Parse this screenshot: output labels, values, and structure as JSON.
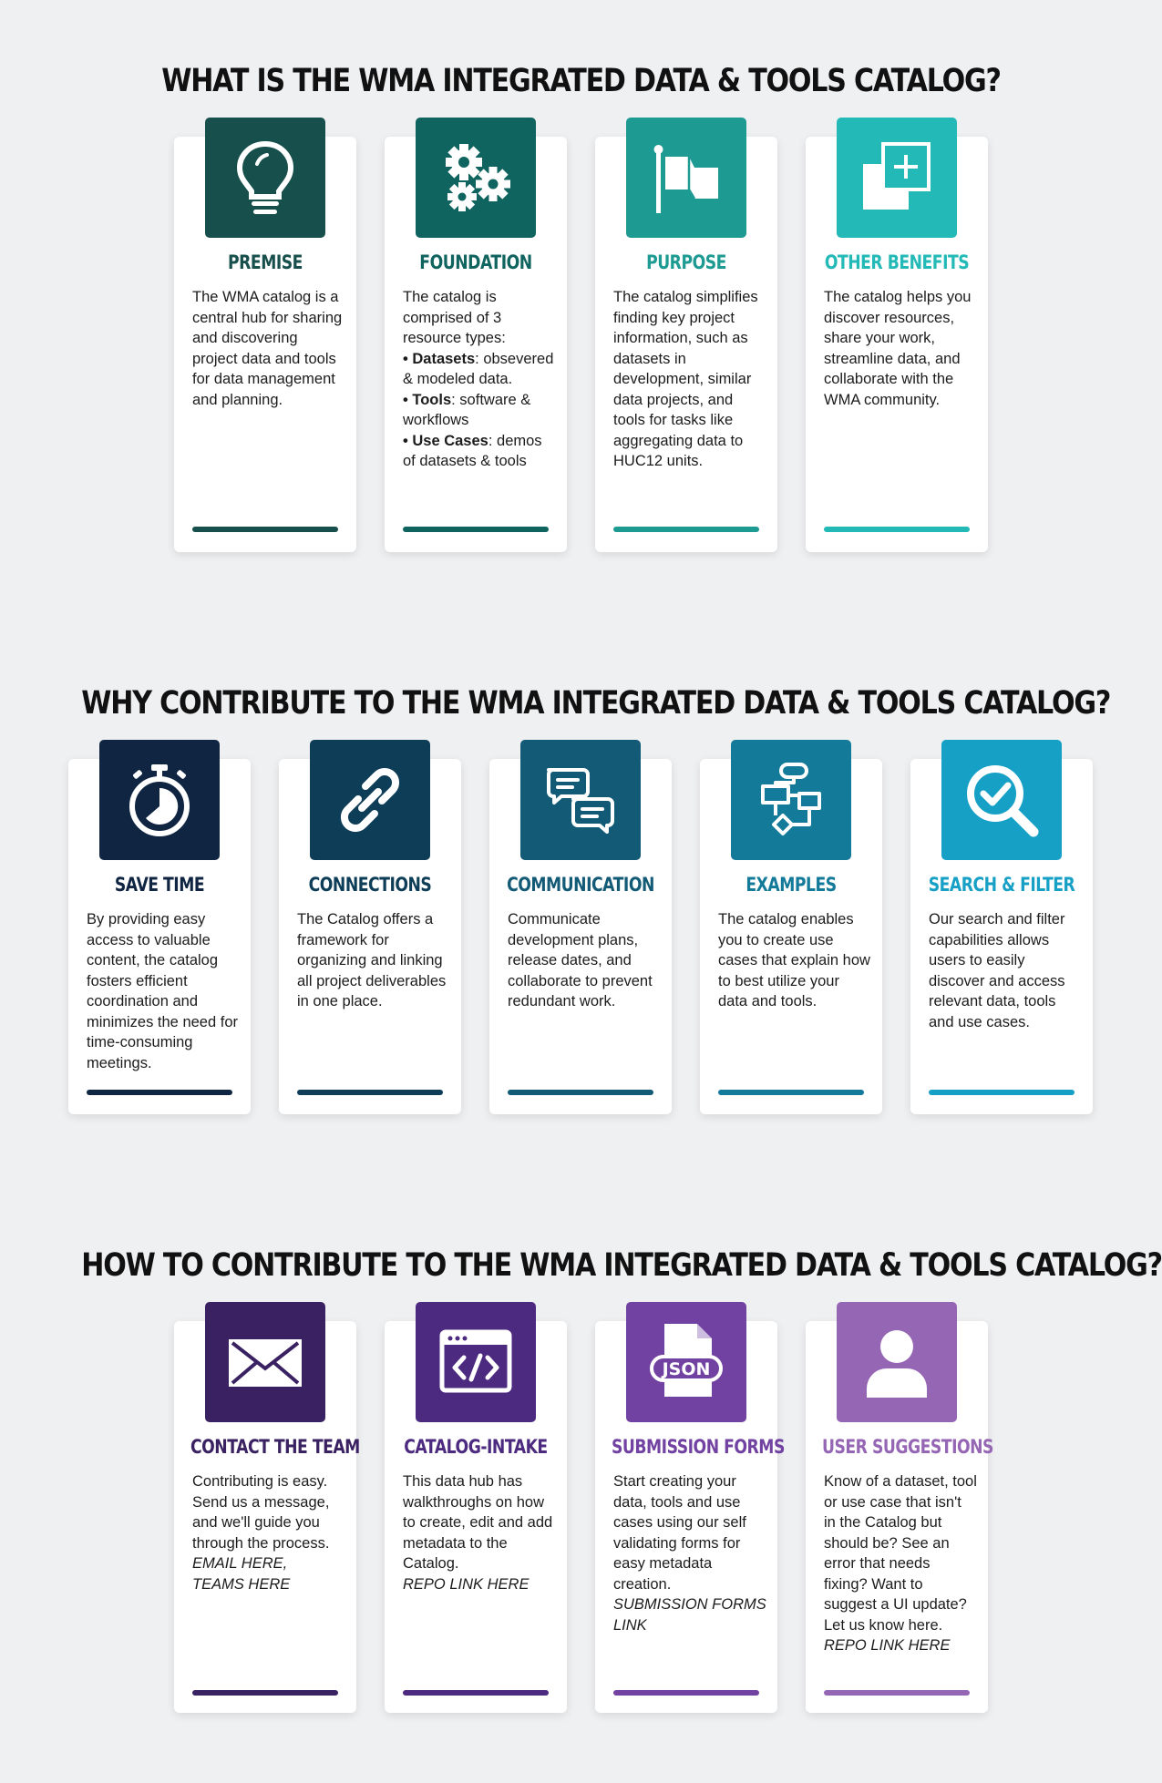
{
  "colors": {
    "background": "#eff0f2",
    "premise": "#174f4c",
    "foundation": "#10645f",
    "purpose": "#1d9a92",
    "other_benefits": "#23b9b6",
    "save_time": "#102542",
    "connections": "#0e3d57",
    "communication": "#125a75",
    "examples": "#137a99",
    "search_filter": "#17a0c6",
    "contact_team": "#3a2262",
    "catalog_intake": "#4c2a80",
    "submission_forms": "#7142a1",
    "user_suggestions": "#9566b4"
  },
  "section_what": {
    "heading": "WHAT IS THE WMA INTEGRATED DATA & TOOLS CATALOG?",
    "cards": [
      {
        "title": "PREMISE",
        "icon": "lightbulb-icon",
        "text": "The WMA catalog is a central hub for sharing and discovering project data and tools for data management and planning."
      },
      {
        "title": "FOUNDATION",
        "icon": "gears-icon",
        "intro": "The catalog is comprised of 3 resource types:",
        "item1_label": "• Datasets",
        "item1_text": ": obsevered & modeled data.",
        "item2_label": "• Tools",
        "item2_text": ": software & workflows",
        "item3_label": "• Use Cases",
        "item3_text": ": demos of datasets & tools"
      },
      {
        "title": "PURPOSE",
        "icon": "flag-icon",
        "text": "The catalog simplifies finding key project information, such as datasets in development, similar data projects, and tools for tasks like aggregating data to HUC12 units."
      },
      {
        "title": "OTHER BENEFITS",
        "icon": "plus-squares-icon",
        "text": "The catalog helps you discover resources, share your work, streamline data, and collaborate with the WMA community."
      }
    ]
  },
  "section_why": {
    "heading": "WHY CONTRIBUTE TO THE WMA INTEGRATED DATA & TOOLS CATALOG?",
    "cards": [
      {
        "title": "SAVE TIME",
        "icon": "stopwatch-icon",
        "text": "By providing easy access to valuable content, the catalog fosters efficient coordination and minimizes the need for time-consuming meetings."
      },
      {
        "title": "CONNECTIONS",
        "icon": "link-icon",
        "text": "The Catalog offers a framework for organizing and linking all project deliverables in one place."
      },
      {
        "title": "COMMUNICATION",
        "icon": "chat-bubbles-icon",
        "text": "Communicate development plans, release dates, and collaborate to prevent redundant work."
      },
      {
        "title": "EXAMPLES",
        "icon": "flowchart-icon",
        "text": "The catalog enables you to create use cases that explain how to best utilize your data and tools."
      },
      {
        "title": "SEARCH & FILTER",
        "icon": "magnifier-check-icon",
        "text": "Our search and filter capabilities allows users to easily discover and access relevant data, tools and use cases."
      }
    ]
  },
  "section_how": {
    "heading": "HOW TO CONTRIBUTE TO THE WMA INTEGRATED DATA & TOOLS CATALOG?",
    "cards": [
      {
        "title": "CONTACT THE TEAM",
        "icon": "envelope-icon",
        "text": "Contributing is easy. Send us a message, and we'll guide you through the process.",
        "link1": "EMAIL HERE,",
        "link2": "TEAMS HERE"
      },
      {
        "title": "CATALOG-INTAKE",
        "icon": "code-window-icon",
        "text": "This data hub has walkthroughs on how to create, edit and add metadata to the Catalog.",
        "link1": "REPO LINK HERE"
      },
      {
        "title": "SUBMISSION FORMS",
        "icon": "json-file-icon",
        "text": "Start creating your data, tools and use cases using our self validating forms for easy metadata creation.",
        "link1": "SUBMISSION FORMS LINK",
        "icon_label": "JSON"
      },
      {
        "title": "USER SUGGESTIONS",
        "icon": "user-icon",
        "text": "Know of a dataset, tool or use case that isn't in the Catalog but should be? See an error that needs fixing? Want to suggest a UI update?  Let us know here.",
        "link1": "REPO LINK HERE"
      }
    ]
  }
}
